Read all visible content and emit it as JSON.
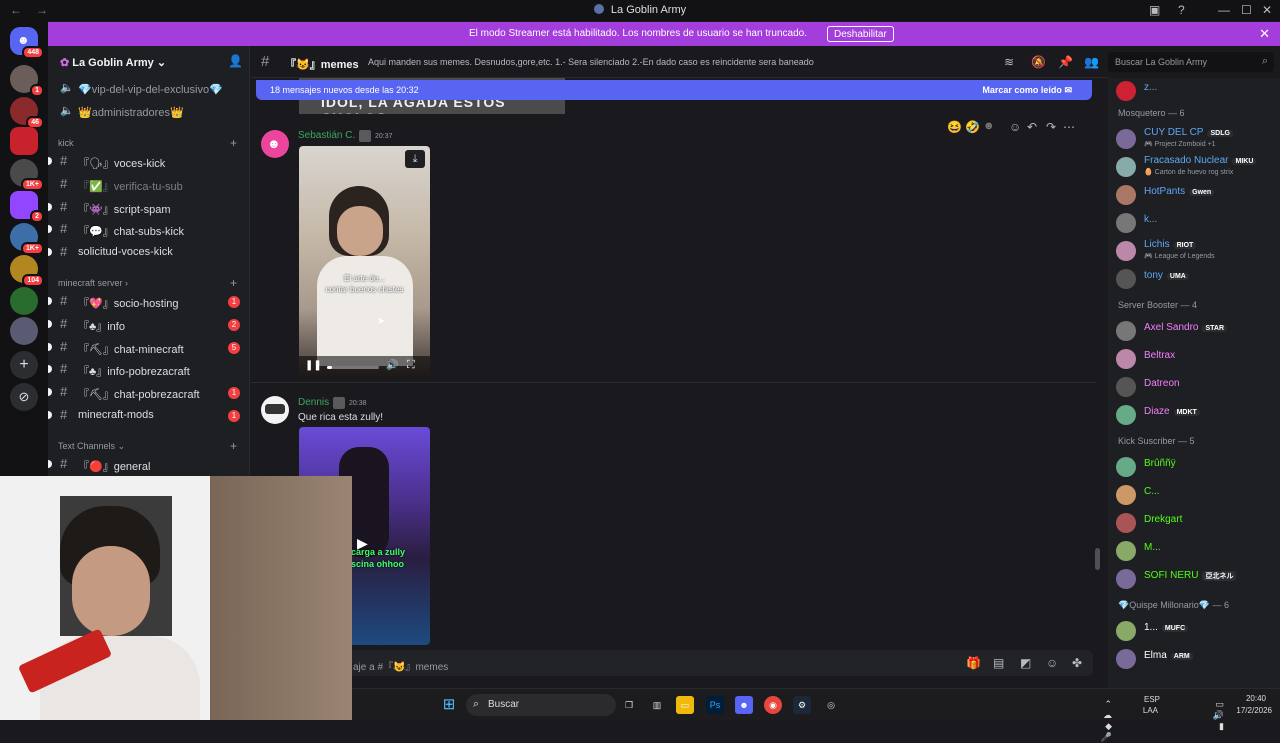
{
  "window": {
    "title": "La Goblin Army"
  },
  "banner": {
    "message": "El modo Streamer está habilitado. Los nombres de usuario se han truncado.",
    "button": "Deshabilitar"
  },
  "servers": [
    {
      "badge": "448"
    },
    {
      "badge": "1"
    },
    {
      "badge": "46"
    },
    {
      "badge": ""
    },
    {
      "badge": "1K+"
    },
    {
      "badge": "2"
    },
    {
      "badge": "1K+"
    },
    {
      "badge": "104"
    },
    {
      "badge": ""
    },
    {
      "badge": ""
    }
  ],
  "sidebar": {
    "server_name": "La Goblin Army",
    "top_channels": [
      {
        "label": "💎vip-del-vip-del-exclusivo💎"
      },
      {
        "label": "👑administradores👑"
      }
    ],
    "categories": [
      {
        "name": "kick",
        "channels": [
          {
            "label": "『🗣』voces-kick",
            "badge": "",
            "unread": true
          },
          {
            "label": "『✅』verifica-tu-sub",
            "badge": "",
            "unread": false,
            "muted": true
          },
          {
            "label": "『👾』script-spam",
            "badge": "",
            "unread": true
          },
          {
            "label": "『💬』chat-subs-kick",
            "badge": "",
            "unread": true
          },
          {
            "label": "solicitud-voces-kick",
            "badge": "",
            "unread": true
          }
        ]
      },
      {
        "name": "minecraft server",
        "channels": [
          {
            "label": "『💖』socio-hosting",
            "badge": "1",
            "unread": true
          },
          {
            "label": "『♣』info",
            "badge": "2",
            "unread": true
          },
          {
            "label": "『⛏』chat-minecraft",
            "badge": "5",
            "unread": true
          },
          {
            "label": "『♣』info-pobrezacraft",
            "badge": "",
            "unread": true
          },
          {
            "label": "『⛏』chat-pobrezacraft",
            "badge": "1",
            "unread": true
          },
          {
            "label": "minecraft-mods",
            "badge": "1",
            "unread": true
          }
        ]
      },
      {
        "name": "Text Channels",
        "channels": [
          {
            "label": "『🔴』general",
            "badge": "",
            "unread": true
          }
        ]
      }
    ]
  },
  "header": {
    "channel_name": "『😺』memes",
    "topic": "Aqui manden sus memes. Desnudos,gore,etc. 1.- Sera silenciado 2.-En dado caso es reincidente sera baneado",
    "search_placeholder": "Buscar La Goblin Army"
  },
  "new_messages_bar": {
    "text": "18 mensajes nuevos desde las 20:32",
    "action": "Marcar como leído"
  },
  "messages": [
    {
      "author": "Sebastián C.",
      "time": "20:37",
      "caption_1": "El arte de...",
      "caption_2": "contar buenos chistes"
    },
    {
      "author": "Dennis",
      "time": "20:38",
      "text": "Que rica esta zully!",
      "caption_1": "carga a zully",
      "caption_2": "scina ohhoo"
    }
  ],
  "previous_image_text": "IDOL, LA AGADA ESTOS CHOLOS",
  "composer": {
    "placeholder": "aje a #『😺』memes"
  },
  "members": {
    "top_member": "z...",
    "groups": [
      {
        "name": "Mosquetero — 6",
        "members": [
          {
            "name": "CUY DEL CP",
            "tag": "SDLG",
            "sub": "🎮 Project Zomboid +1",
            "color": "#5fa8f5"
          },
          {
            "name": "Fracasado Nuclear",
            "tag": "MIKU",
            "sub": "🥚 Carton de huevo rog strix",
            "color": "#5fa8f5"
          },
          {
            "name": "HotPants",
            "tag": "Gwen",
            "sub": "",
            "color": "#5fa8f5"
          },
          {
            "name": "k...",
            "tag": "",
            "sub": "",
            "color": "#5fa8f5"
          },
          {
            "name": "Lichis",
            "tag": "RIOT",
            "sub": "🎮 League of Legends",
            "color": "#5fa8f5"
          },
          {
            "name": "tony",
            "tag": "UMA",
            "sub": "",
            "color": "#5fa8f5"
          }
        ]
      },
      {
        "name": "Server Booster — 4",
        "members": [
          {
            "name": "Axel Sandro",
            "tag": "STAR",
            "sub": "",
            "color": "#f47fff"
          },
          {
            "name": "Beltrax",
            "tag": "",
            "sub": "",
            "color": "#f47fff"
          },
          {
            "name": "Datreon",
            "tag": "",
            "sub": "",
            "color": "#f47fff"
          },
          {
            "name": "Diaze",
            "tag": "MDKT",
            "sub": "",
            "color": "#f47fff"
          }
        ]
      },
      {
        "name": "Kick Suscriber — 5",
        "members": [
          {
            "name": "Brûññÿ",
            "tag": "",
            "sub": "",
            "color": "#53fc18"
          },
          {
            "name": "C...",
            "tag": "",
            "sub": "",
            "color": "#53fc18"
          },
          {
            "name": "Drekgart",
            "tag": "",
            "sub": "",
            "color": "#53fc18"
          },
          {
            "name": "M...",
            "tag": "",
            "sub": "",
            "color": "#53fc18"
          },
          {
            "name": "SOFI NERU",
            "tag": "亞北ネル",
            "sub": "",
            "color": "#53fc18"
          }
        ]
      },
      {
        "name": "💎Quispe Millonario💎 — 6",
        "members": [
          {
            "name": "1...",
            "tag": "MUFC",
            "sub": "",
            "color": "#ffffff"
          },
          {
            "name": "Elma",
            "tag": "ARM",
            "sub": "",
            "color": "#ffffff"
          }
        ]
      }
    ]
  },
  "taskbar": {
    "search": "Buscar",
    "lang": "ESP",
    "lang2": "LAA",
    "time": "20:40",
    "date": "17/2/2026"
  },
  "colors": {
    "banner": "#a33ddb",
    "accent": "#5865f2",
    "online": "#3ba55d"
  }
}
